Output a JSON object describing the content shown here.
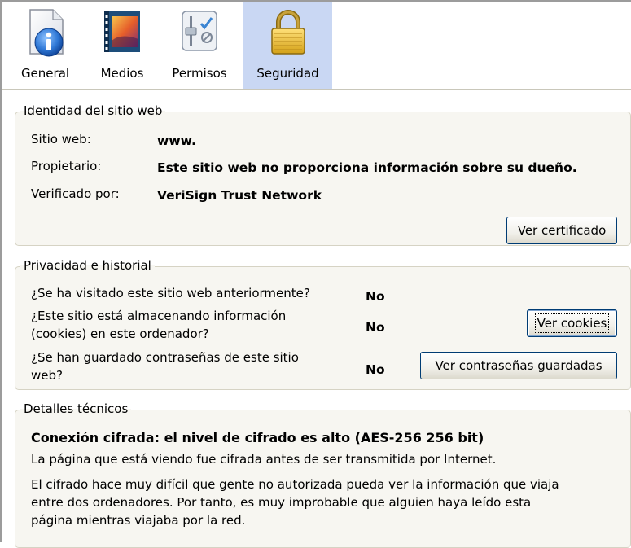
{
  "tabs": [
    {
      "label": "General",
      "icon": "info-icon"
    },
    {
      "label": "Medios",
      "icon": "media-icon"
    },
    {
      "label": "Permisos",
      "icon": "permissions-icon"
    },
    {
      "label": "Seguridad",
      "icon": "lock-icon",
      "active": true
    }
  ],
  "identity": {
    "legend": "Identidad del sitio web",
    "website_label": "Sitio web:",
    "website_value": "www.",
    "owner_label": "Propietario:",
    "owner_value": "Este sitio web no proporciona información sobre su dueño.",
    "verified_label": "Verificado por:",
    "verified_value": "VeriSign Trust Network",
    "cert_button": "Ver certificado"
  },
  "privacy": {
    "legend": "Privacidad e historial",
    "q1": "¿Se ha visitado este sitio web anteriormente?",
    "a1": "No",
    "q2_line1": "¿Este sitio está almacenando información",
    "q2_line2": "(cookies) en este ordenador?",
    "a2": "No",
    "cookies_button": "Ver cookies",
    "q3_line1": "¿Se han guardado contraseñas de este sitio",
    "q3_line2": "web?",
    "a3": "No",
    "passwords_button": "Ver contraseñas guardadas"
  },
  "technical": {
    "legend": "Detalles técnicos",
    "title": "Conexión cifrada: el nivel de cifrado es alto (AES-256 256 bit)",
    "line1": "La página que está viendo fue cifrada antes de ser transmitida por Internet.",
    "para_line1": "El cifrado hace muy difícil que gente no autorizada pueda ver la información que viaja",
    "para_line2": "entre dos ordenadores. Por tanto, es muy improbable que alguien haya leído esta",
    "para_line3": "página mientras viajaba por la red."
  }
}
